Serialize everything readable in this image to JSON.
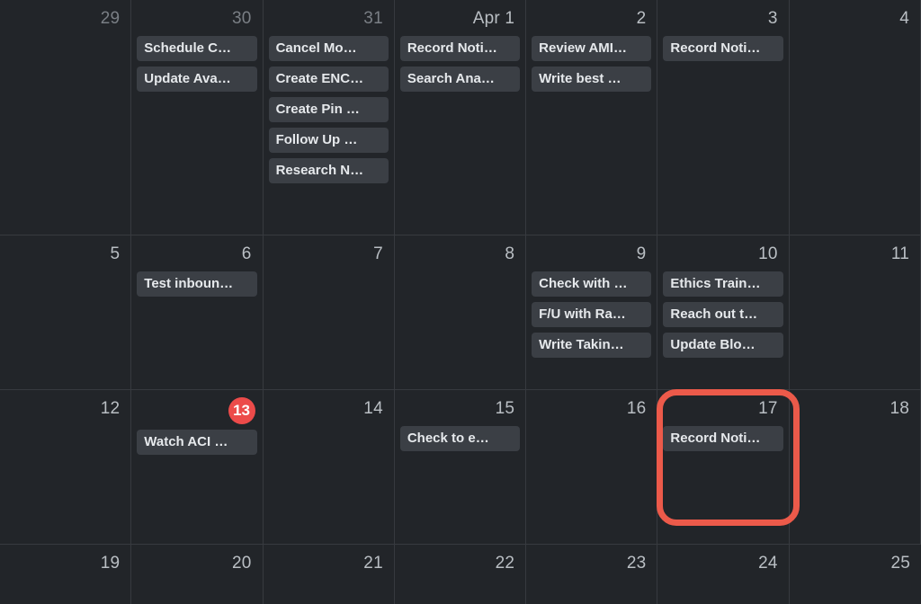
{
  "today_value": "13",
  "highlight_day": "17",
  "weeks": [
    {
      "days": [
        {
          "label": "29",
          "dim": true,
          "events": []
        },
        {
          "label": "30",
          "dim": true,
          "events": [
            "Schedule C…",
            "Update Ava…"
          ]
        },
        {
          "label": "31",
          "dim": true,
          "events": [
            "Cancel Mo…",
            "Create ENC…",
            "Create Pin …",
            "Follow Up …",
            "Research N…"
          ]
        },
        {
          "label": "Apr 1",
          "dim": false,
          "events": [
            "Record Noti…",
            "Search Ana…"
          ]
        },
        {
          "label": "2",
          "dim": false,
          "events": [
            "Review AMI…",
            "Write best …"
          ]
        },
        {
          "label": "3",
          "dim": false,
          "events": [
            "Record Noti…"
          ]
        },
        {
          "label": "4",
          "dim": false,
          "events": []
        }
      ]
    },
    {
      "days": [
        {
          "label": "5",
          "dim": false,
          "events": []
        },
        {
          "label": "6",
          "dim": false,
          "events": [
            "Test inboun…"
          ]
        },
        {
          "label": "7",
          "dim": false,
          "events": []
        },
        {
          "label": "8",
          "dim": false,
          "events": []
        },
        {
          "label": "9",
          "dim": false,
          "events": [
            "Check with …",
            "F/U with Ra…",
            "Write Takin…"
          ]
        },
        {
          "label": "10",
          "dim": false,
          "events": [
            "Ethics Train…",
            "Reach out t…",
            "Update Blo…"
          ]
        },
        {
          "label": "11",
          "dim": false,
          "events": []
        }
      ]
    },
    {
      "days": [
        {
          "label": "12",
          "dim": false,
          "events": []
        },
        {
          "label": "13",
          "dim": false,
          "today": true,
          "events": [
            "Watch ACI …"
          ]
        },
        {
          "label": "14",
          "dim": false,
          "events": []
        },
        {
          "label": "15",
          "dim": false,
          "events": [
            "Check to e…"
          ]
        },
        {
          "label": "16",
          "dim": false,
          "events": []
        },
        {
          "label": "17",
          "dim": false,
          "events": [
            "Record Noti…"
          ]
        },
        {
          "label": "18",
          "dim": false,
          "events": []
        }
      ]
    },
    {
      "days": [
        {
          "label": "19",
          "dim": false,
          "events": []
        },
        {
          "label": "20",
          "dim": false,
          "events": []
        },
        {
          "label": "21",
          "dim": false,
          "events": []
        },
        {
          "label": "22",
          "dim": false,
          "events": []
        },
        {
          "label": "23",
          "dim": false,
          "events": []
        },
        {
          "label": "24",
          "dim": false,
          "events": []
        },
        {
          "label": "25",
          "dim": false,
          "events": []
        }
      ]
    }
  ]
}
